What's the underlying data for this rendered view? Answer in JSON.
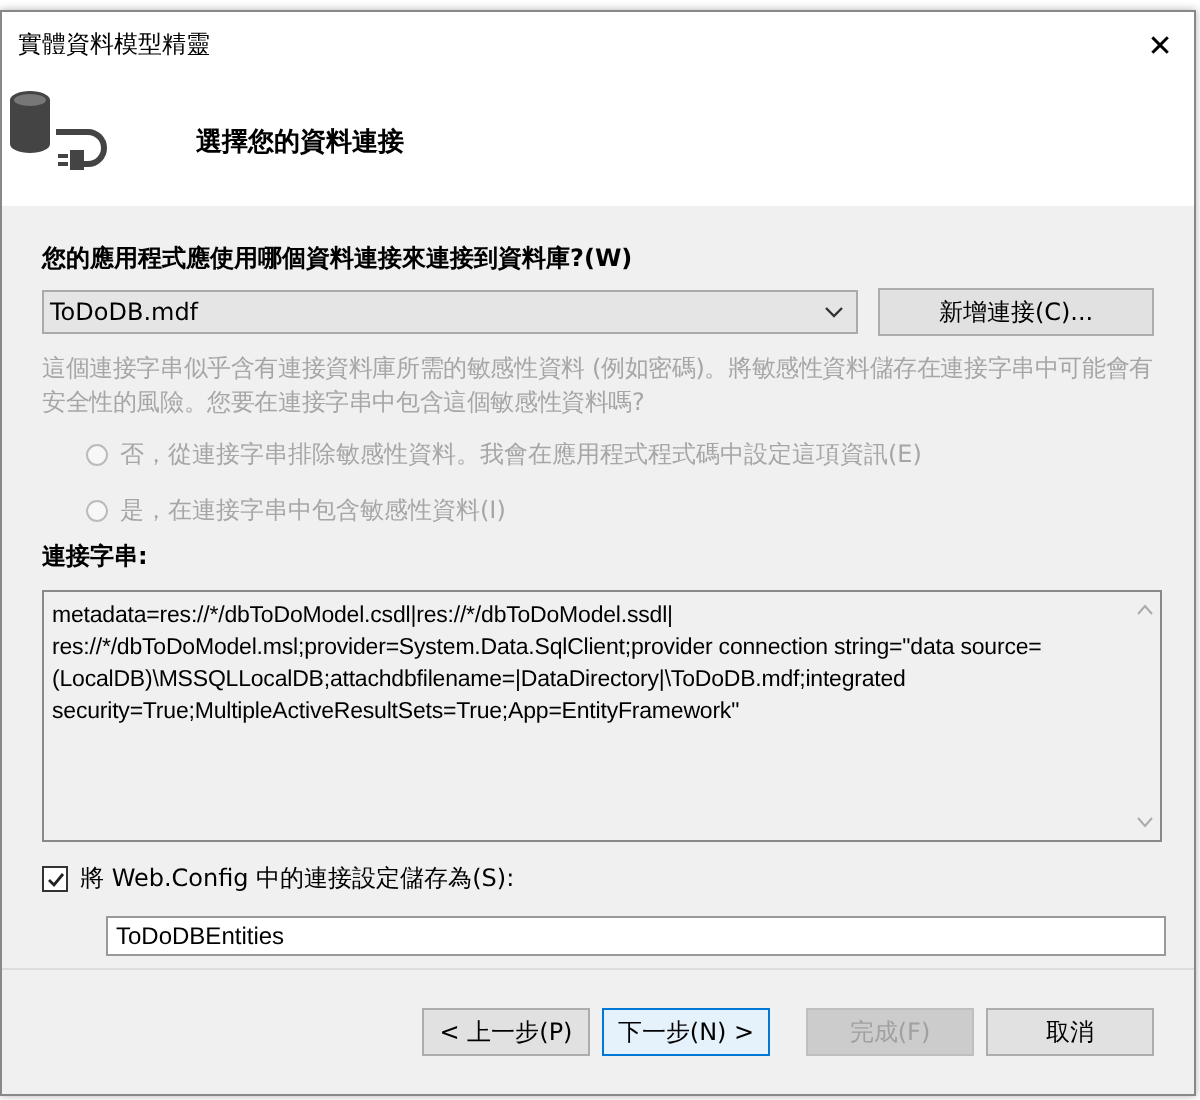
{
  "window": {
    "title": "實體資料模型精靈",
    "close": "✕"
  },
  "header": {
    "title": "選擇您的資料連接"
  },
  "connection": {
    "label": "您的應用程式應使用哪個資料連接來連接到資料庫?(W)",
    "value": "ToDoDB.mdf",
    "new_button": "新增連接(C)...",
    "warning": "這個連接字串似乎含有連接資料庫所需的敏感性資料 (例如密碼)。將敏感性資料儲存在連接字串中可能會有安全性的風險。您要在連接字串中包含這個敏感性資料嗎?",
    "options": [
      {
        "label": "否，從連接字串排除敏感性資料。我會在應用程式程式碼中設定這項資訊(E)",
        "selected": false,
        "disabled": true
      },
      {
        "label": "是，在連接字串中包含敏感性資料(I)",
        "selected": false,
        "disabled": true
      }
    ],
    "string_label": "連接字串:",
    "string_lines": [
      "metadata=res://*/dbToDoModel.csdl|res://*/dbToDoModel.ssdl|",
      "res://*/dbToDoModel.msl;provider=System.Data.SqlClient;provider connection string=\"data source=",
      "(LocalDB)\\MSSQLLocalDB;attachdbfilename=|DataDirectory|\\ToDoDB.mdf;integrated",
      "security=True;MultipleActiveResultSets=True;App=EntityFramework\""
    ]
  },
  "save": {
    "label": "將 Web.Config 中的連接設定儲存為(S):",
    "checked": true,
    "value": "ToDoDBEntities"
  },
  "buttons": [
    {
      "label": "< 上一步(P)",
      "default": false,
      "disabled": false
    },
    {
      "label": "下一步(N) >",
      "default": true,
      "disabled": false
    },
    {
      "label": "完成(F)",
      "default": false,
      "disabled": true
    },
    {
      "label": "取消",
      "default": false,
      "disabled": false
    }
  ]
}
